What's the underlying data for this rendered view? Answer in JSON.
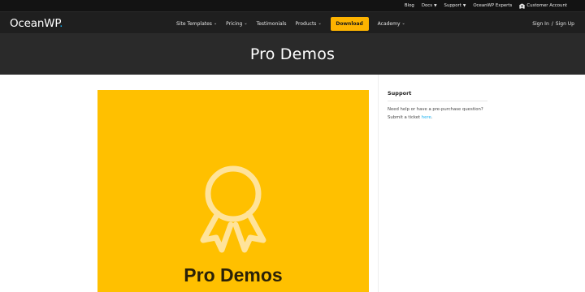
{
  "topbar": {
    "links": [
      {
        "label": "Blog"
      },
      {
        "label": "Docs"
      },
      {
        "label": "Support"
      },
      {
        "label": "OceanWP Experts"
      }
    ],
    "account": {
      "label": "Customer Account",
      "icon": "account-icon"
    }
  },
  "nav": {
    "logo": {
      "text": "OceanWP",
      "dot": "."
    },
    "items": [
      {
        "label": "Site Templates"
      },
      {
        "label": "Pricing"
      },
      {
        "label": "Testimonials"
      },
      {
        "label": "Products"
      }
    ],
    "download_label": "Download",
    "academy_label": "Academy",
    "signin": {
      "signin": "Sign In",
      "separator": "/",
      "signup": "Sign Up"
    }
  },
  "hero": {
    "title": "Pro Demos"
  },
  "card": {
    "title": "Pro Demos",
    "icon": "award-ribbon-icon"
  },
  "sidebar": {
    "title": "Support",
    "text_line1": "Need help or have a pre-purchase question?",
    "text_line2": "Submit a ticket",
    "link_label": "here",
    "period": "."
  },
  "colors": {
    "accent": "#13aff0",
    "download_button": "#fdb300",
    "card_background": "#ffc000",
    "topbar": "#131313",
    "nav": "#1f1f1f",
    "hero": "#2a2a2a"
  }
}
